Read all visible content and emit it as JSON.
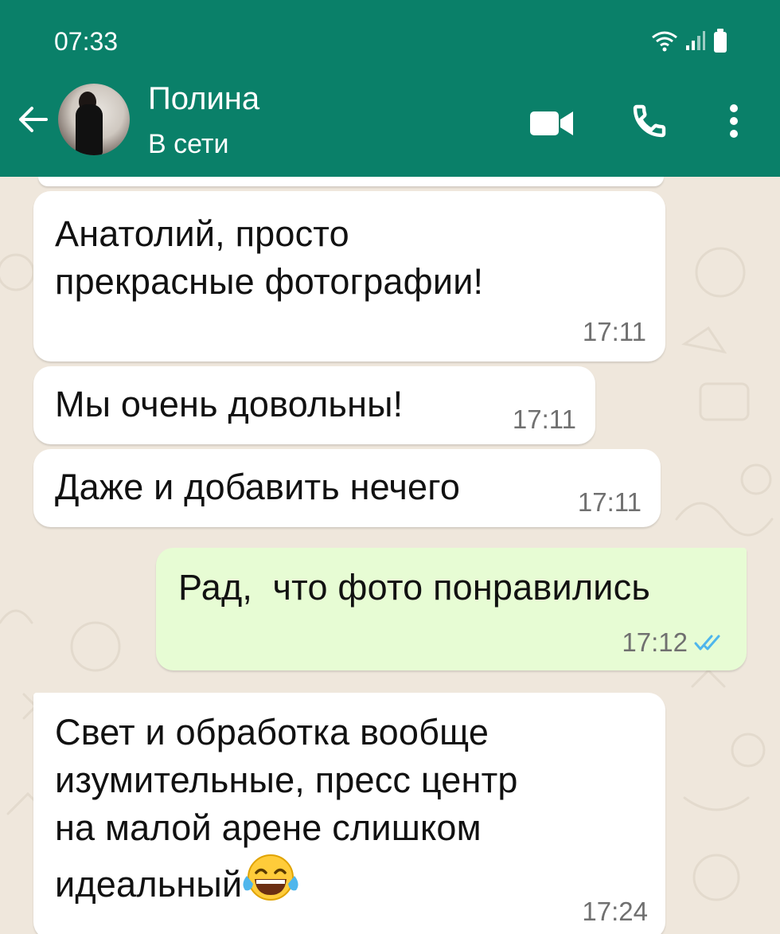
{
  "status_bar": {
    "time": "07:33"
  },
  "header": {
    "contact_name": "Полина",
    "contact_status": "В сети",
    "colors": {
      "bar": "#0a8069",
      "text": "#ffffff"
    },
    "icons": [
      "back-arrow-icon",
      "video-call-icon",
      "phone-call-icon",
      "more-options-icon"
    ]
  },
  "messages": [
    {
      "direction": "incoming",
      "text": "Анатолий, просто\nпрекрасные фотографии!",
      "time": "17:11"
    },
    {
      "direction": "incoming",
      "text": "Мы очень довольны!",
      "time": "17:11"
    },
    {
      "direction": "incoming",
      "text": "Даже и добавить нечего",
      "time": "17:11"
    },
    {
      "direction": "outgoing",
      "text": "Рад,  что фото понравились",
      "time": "17:12",
      "status": "read"
    },
    {
      "direction": "incoming",
      "text": "Свет и обработка вообще\nизумительные, пресс центр\nна малой арене слишком\nидеальный",
      "time": "17:24",
      "emoji": "face-with-tears-of-joy-icon"
    }
  ],
  "colors": {
    "incoming_bubble": "#ffffff",
    "outgoing_bubble": "#e7fcd4",
    "read_ticks": "#4fb6ec",
    "chat_background": "#efe7dc"
  }
}
